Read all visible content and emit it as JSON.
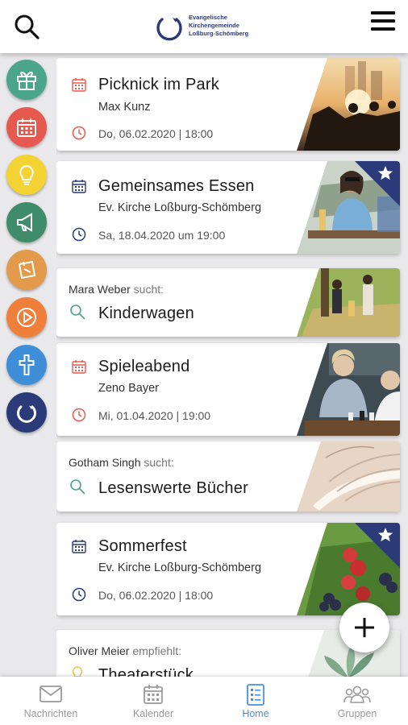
{
  "header": {
    "logo_lines": [
      "Evangelische",
      "Kirchengemeinde",
      "Loßburg-Schömberg"
    ]
  },
  "sidebar": {
    "categories": [
      {
        "name": "gift",
        "color": "#4aa58a"
      },
      {
        "name": "calendar",
        "color": "#e6594f"
      },
      {
        "name": "lightbulb",
        "color": "#f2d333"
      },
      {
        "name": "megaphone",
        "color": "#3f8c6a"
      },
      {
        "name": "note",
        "color": "#e39a4a"
      },
      {
        "name": "play",
        "color": "#ef7f3a"
      },
      {
        "name": "cross",
        "color": "#3e8fd8"
      },
      {
        "name": "logo",
        "color": "#2b3a78"
      }
    ]
  },
  "feed": {
    "cards": [
      {
        "type": "event",
        "title": "Picknick im Park",
        "subtitle": "Max Kunz",
        "date": "Do, 06.02.2020 | 18:00",
        "icon_color": "#e6594f",
        "starred": false
      },
      {
        "type": "event",
        "title": "Gemeinsames Essen",
        "subtitle": "Ev. Kirche Loßburg-Schömberg",
        "date": "Sa, 18.04.2020 um 19:00",
        "icon_color": "#2b3a78",
        "starred": true
      },
      {
        "type": "search",
        "person": "Mara Weber",
        "verb": "sucht:",
        "title": "Kinderwagen"
      },
      {
        "type": "event",
        "title": "Spieleabend",
        "subtitle": "Zeno Bayer",
        "date": "Mi, 01.04.2020 | 19:00",
        "icon_color": "#e6594f",
        "starred": false
      },
      {
        "type": "search",
        "person": "Gotham Singh",
        "verb": "sucht:",
        "title": "Lesenswerte Bücher"
      },
      {
        "type": "event",
        "title": "Sommerfest",
        "subtitle": "Ev. Kirche Loßburg-Schömberg",
        "date": "Do, 06.02.2020 | 18:00",
        "icon_color": "#2b3a78",
        "starred": true
      },
      {
        "type": "recommend",
        "person": "Oliver Meier",
        "verb": "empfiehlt:",
        "title": "Theaterstück"
      }
    ]
  },
  "fab": {
    "icon": "plus-icon"
  },
  "bottom_nav": {
    "items": [
      {
        "label": "Nachrichten",
        "icon": "envelope-icon",
        "active": false
      },
      {
        "label": "Kalender",
        "icon": "calendar-icon",
        "active": false
      },
      {
        "label": "Home",
        "icon": "list-icon",
        "active": true
      },
      {
        "label": "Gruppen",
        "icon": "group-icon",
        "active": false
      }
    ]
  }
}
